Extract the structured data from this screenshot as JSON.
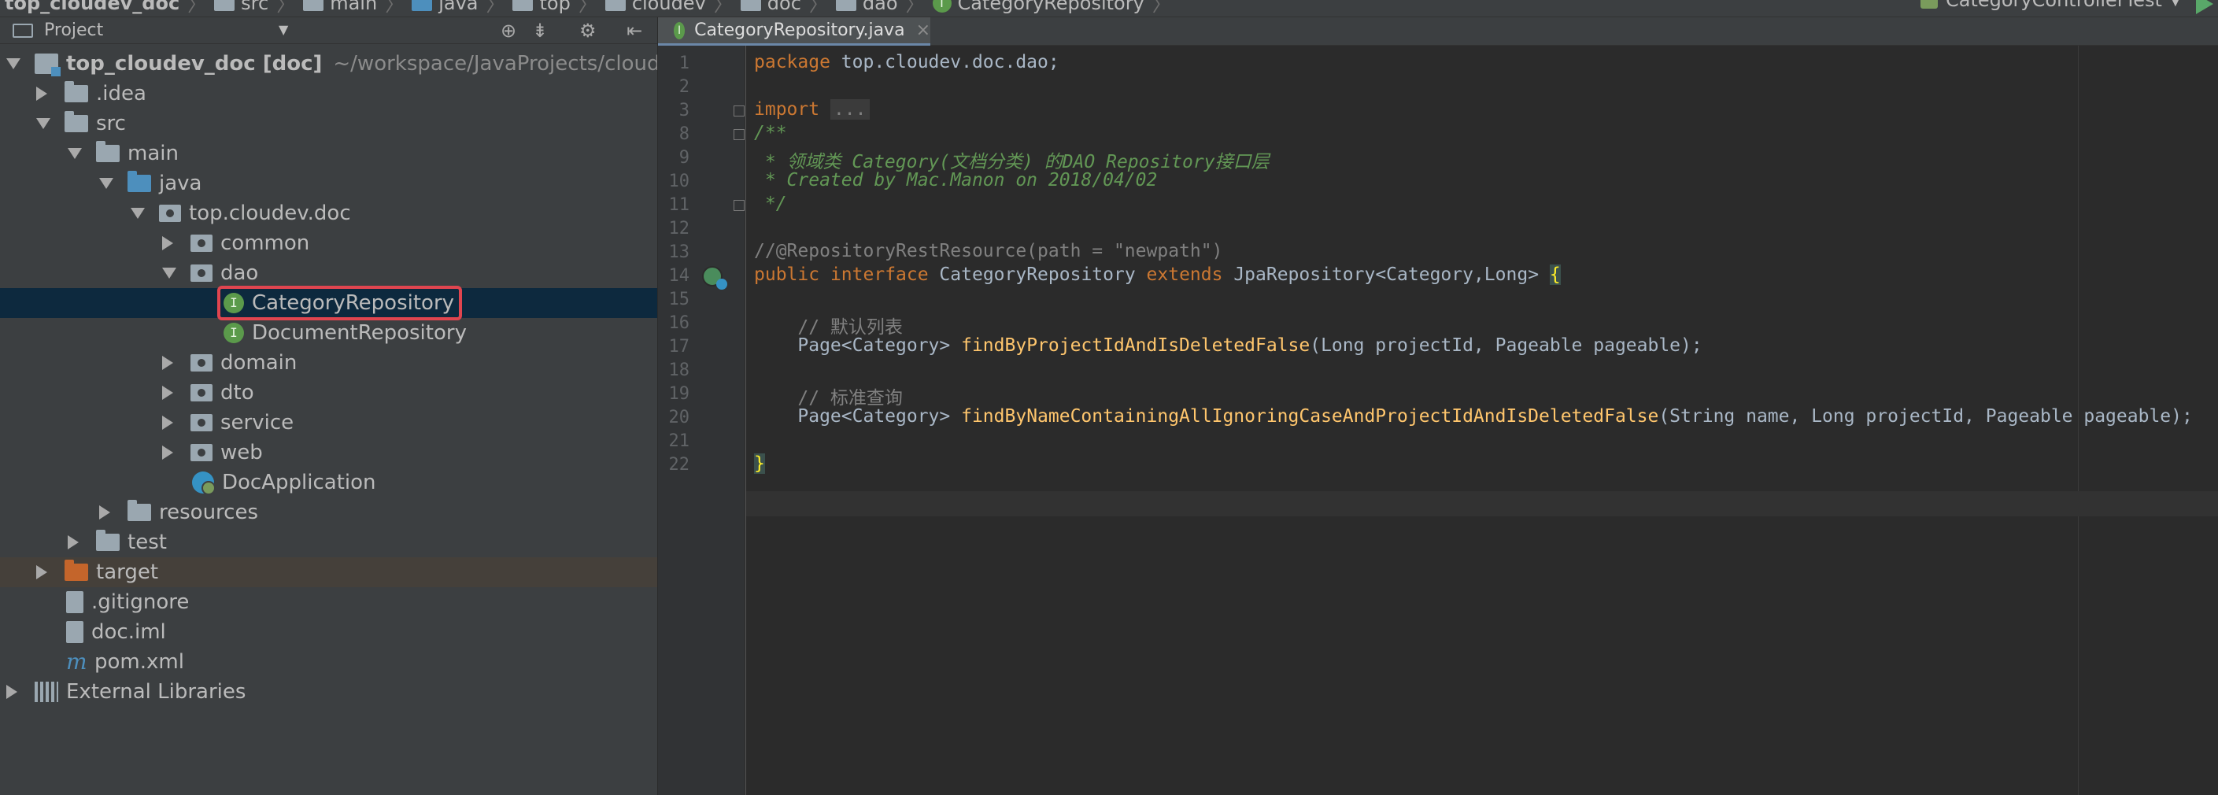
{
  "navbar": {
    "crumbs": [
      "top_cloudev_doc",
      "src",
      "main",
      "java",
      "top",
      "cloudev",
      "doc",
      "dao",
      "CategoryRepository"
    ],
    "run_config": "CategoryControllerTest"
  },
  "project_panel": {
    "title": "Project",
    "tree": [
      {
        "label": "top_cloudev_doc [doc]",
        "hint": "~/workspace/JavaProjects/cloudev/to"
      },
      {
        "label": ".idea"
      },
      {
        "label": "src"
      },
      {
        "label": "main"
      },
      {
        "label": "java"
      },
      {
        "label": "top.cloudev.doc"
      },
      {
        "label": "common"
      },
      {
        "label": "dao"
      },
      {
        "label": "CategoryRepository"
      },
      {
        "label": "DocumentRepository"
      },
      {
        "label": "domain"
      },
      {
        "label": "dto"
      },
      {
        "label": "service"
      },
      {
        "label": "web"
      },
      {
        "label": "DocApplication"
      },
      {
        "label": "resources"
      },
      {
        "label": "test"
      },
      {
        "label": "target"
      },
      {
        "label": ".gitignore"
      },
      {
        "label": "doc.iml"
      },
      {
        "label": "pom.xml"
      },
      {
        "label": "External Libraries"
      }
    ]
  },
  "editor": {
    "tab_label": "CategoryRepository.java",
    "iface_glyph": "I",
    "line_numbers": [
      "1",
      "2",
      "3",
      "8",
      "9",
      "10",
      "11",
      "12",
      "13",
      "14",
      "15",
      "16",
      "17",
      "18",
      "19",
      "20",
      "21",
      "22"
    ],
    "code": {
      "l1_kw": "package",
      "l1_rest": " top.cloudev.doc.dao;",
      "l3_kw": "import",
      "l3_fold": "...",
      "l8": "/**",
      "l9": " * 领域类 Category(文档分类) 的DAO Repository接口层",
      "l10": " * Created by Mac.Manon on 2018/04/02",
      "l11": " */",
      "l13": "//@RepositoryRestResource(path = \"newpath\")",
      "l14_kw1": "public",
      "l14_kw2": "interface",
      "l14_name": " CategoryRepository ",
      "l14_kw3": "extends",
      "l14_rest": " JpaRepository<Category,Long> ",
      "l14_brace": "{",
      "l16": "    // 默认列表",
      "l17_pre": "    Page<Category> ",
      "l17_fn": "findByProjectIdAndIsDeletedFalse",
      "l17_args": "(Long projectId, Pageable pageable);",
      "l19": "    // 标准查询",
      "l20_pre": "    Page<Category> ",
      "l20_fn": "findByNameContainingAllIgnoringCaseAndProjectIdAndIsDeletedFalse",
      "l20_args": "(String name, Long projectId, Pageable pageable);",
      "l22": "}"
    }
  }
}
